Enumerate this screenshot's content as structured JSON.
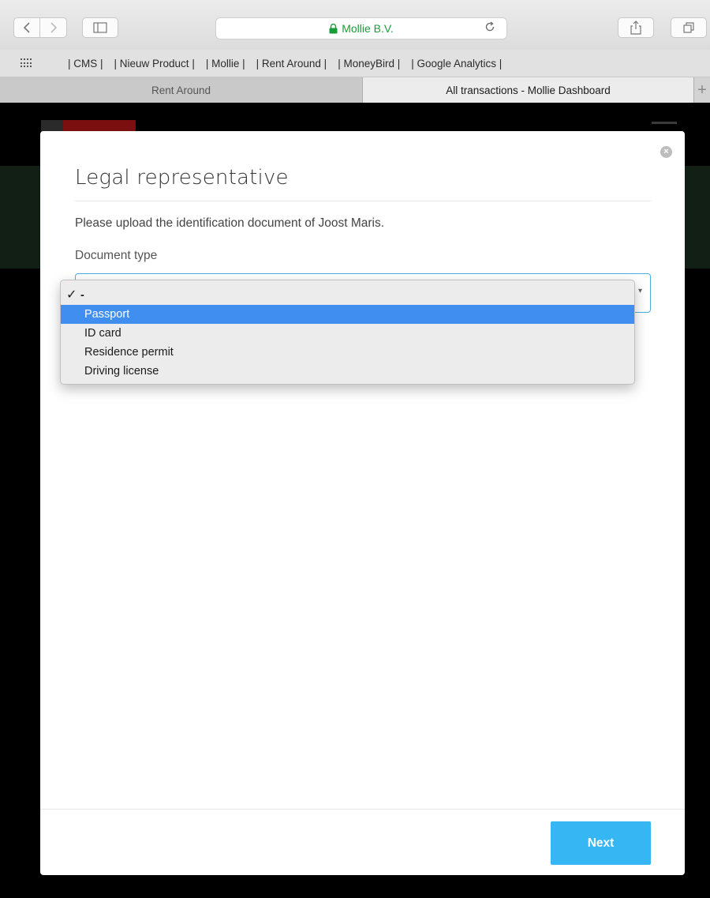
{
  "browser": {
    "url_display": "Mollie B.V.",
    "bookmarks": [
      "| CMS |",
      "| Nieuw Product |",
      "| Mollie |",
      "| Rent Around |",
      "| MoneyBird |",
      "| Google Analytics |"
    ],
    "tabs": [
      {
        "label": "Rent Around",
        "active": false
      },
      {
        "label": "All transactions - Mollie Dashboard",
        "active": true
      }
    ],
    "new_tab_glyph": "+",
    "accent_secure": "#1a9b3a"
  },
  "modal": {
    "title": "Legal representative",
    "instruction": "Please upload the identification document of Joost Maris.",
    "document_type_label": "Document type",
    "next_label": "Next",
    "close_glyph": "×",
    "accent": "#36b6f2"
  },
  "dropdown": {
    "checked_glyph": "✓",
    "options": [
      {
        "label": "-",
        "checked": true,
        "highlighted": false
      },
      {
        "label": "Passport",
        "checked": false,
        "highlighted": true
      },
      {
        "label": "ID card",
        "checked": false,
        "highlighted": false
      },
      {
        "label": "Residence permit",
        "checked": false,
        "highlighted": false
      },
      {
        "label": "Driving license",
        "checked": false,
        "highlighted": false
      }
    ],
    "highlight_color": "#3f8ef0"
  },
  "icons": [
    "back-icon",
    "forward-icon",
    "sidebar-icon",
    "lock-icon",
    "reload-icon",
    "share-icon",
    "tabs-icon",
    "grid-icon",
    "close-icon",
    "checkmark-icon",
    "chevron-down-icon"
  ]
}
